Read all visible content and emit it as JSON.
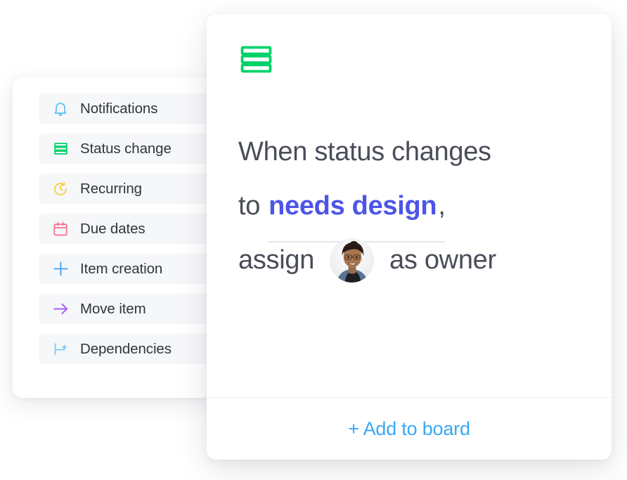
{
  "colors": {
    "accent_blue": "#4c55e8",
    "link_blue": "#38a9f4",
    "green": "#00d26a",
    "bell_blue": "#59c2f7",
    "yellow": "#f7ce3e",
    "pink": "#f7708f",
    "plus_blue": "#3b9ef5",
    "purple": "#a855f7",
    "dep_blue": "#7ec9f5",
    "text": "#4a4d59",
    "item_bg": "#f6f7f9"
  },
  "sidebar": {
    "items": [
      {
        "label": "Notifications",
        "icon": "bell-icon"
      },
      {
        "label": "Status change",
        "icon": "status-bars-icon"
      },
      {
        "label": "Recurring",
        "icon": "recurring-clock-icon"
      },
      {
        "label": "Due dates",
        "icon": "calendar-icon"
      },
      {
        "label": "Item creation",
        "icon": "plus-icon"
      },
      {
        "label": "Move item",
        "icon": "arrow-right-icon"
      },
      {
        "label": "Dependencies",
        "icon": "dependency-icon"
      }
    ]
  },
  "recipe": {
    "badge_icon": "status-bars-icon",
    "line1": "When status changes",
    "line2_prefix": "to",
    "line2_status": "needs design",
    "line2_comma": ",",
    "line3_prefix": "assign",
    "line3_suffix": "as owner",
    "avatar_alt": "person-avatar"
  },
  "footer": {
    "add_label": "+ Add to board"
  }
}
